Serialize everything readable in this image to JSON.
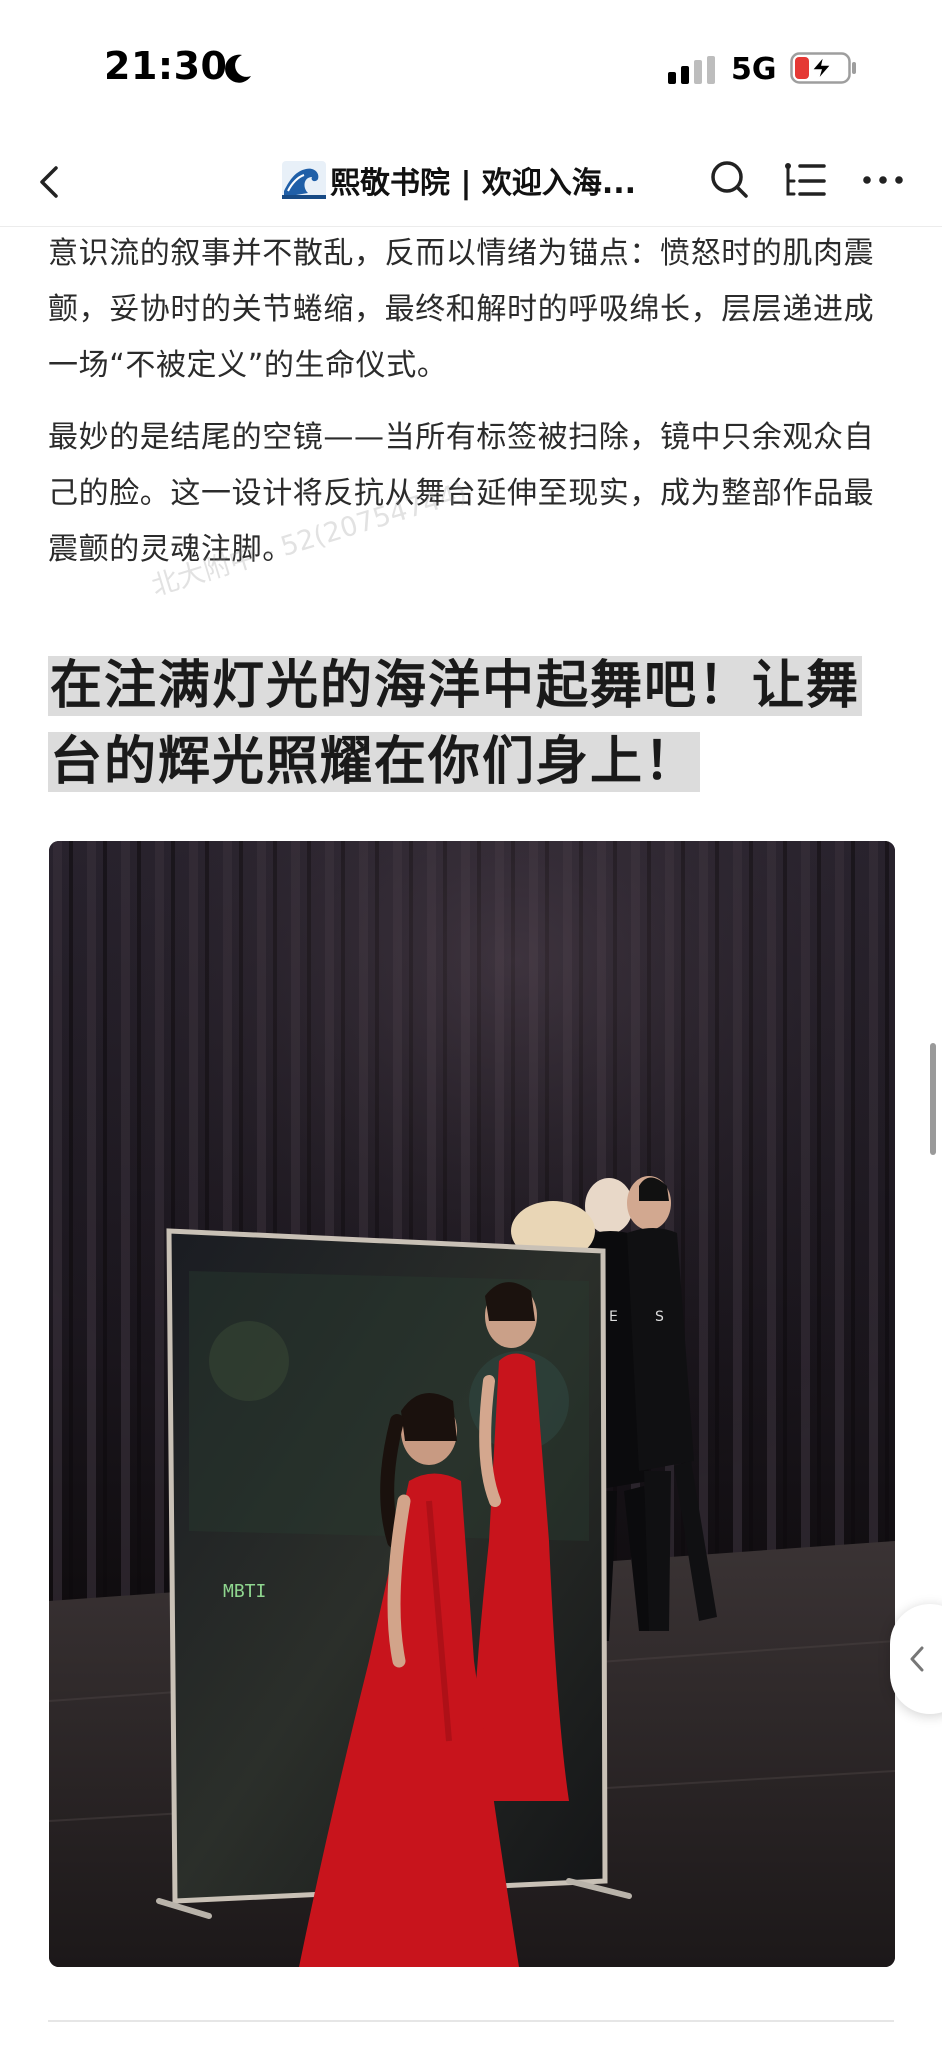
{
  "status_bar": {
    "time": "21:30",
    "network": "5G",
    "moon_icon": "moon-icon",
    "signal_icon": "signal-icon",
    "battery_icon": "battery-charging-icon",
    "battery_color": "#e53935"
  },
  "nav": {
    "back_icon": "chevron-left-icon",
    "title": "熙敬书院 | 欢迎入海...",
    "search_icon": "search-icon",
    "toc_icon": "list-icon",
    "more_icon": "more-icon"
  },
  "article": {
    "paragraph_1": "意识流的叙事并不散乱，反而以情绪为锚点：愤怒时的肌肉震颤，妥协时的关节蜷缩，最终和解时的呼吸绵长，层层递进成一场“不被定义”的生命仪式。",
    "paragraph_2": "最妙的是结尾的空镜——当所有标签被扫除，镜中只余观众自己的脸。这一设计将反抗从舞台延伸至现实，成为整部作品最震颤的灵魂注脚。",
    "watermark": "北大附中 - 52(20754744)",
    "heading": "在注满灯光的海洋中起舞吧！让舞台的辉光照耀在你们身上！",
    "highlight_color": "#dcdcdc",
    "photo": {
      "mirror_text": "MBTI",
      "shirt_letter_1": "E",
      "shirt_letter_2": "S",
      "dress_color": "#c8141c"
    }
  },
  "side": {
    "float_button_icon": "chevron-left-icon"
  }
}
